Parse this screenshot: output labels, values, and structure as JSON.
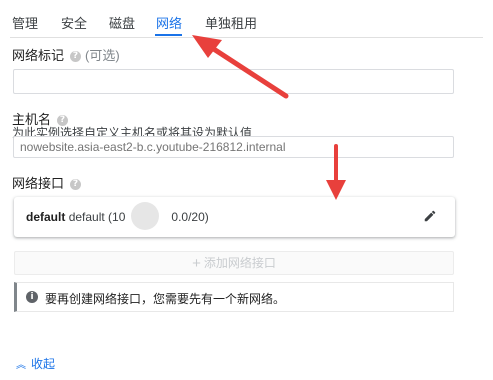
{
  "tabs": [
    {
      "label": "管理"
    },
    {
      "label": "安全"
    },
    {
      "label": "磁盘"
    },
    {
      "label": "网络"
    },
    {
      "label": "单独租用"
    }
  ],
  "network_tag": {
    "label": "网络标记",
    "optional": "(可选)",
    "value": ""
  },
  "hostname": {
    "label": "主机名",
    "description": "为此实例选择自定义主机名或将其设为默认值",
    "placeholder": "nowebsite.asia-east2-b.c.youtube-216812.internal"
  },
  "interfaces": {
    "label": "网络接口",
    "item_name": "default",
    "item_detail_prefix": "default (10",
    "item_detail_suffix": "0.0/20)"
  },
  "add_interface_label": "添加网络接口",
  "notice_text": "要再创建网络接口，您需要先有一个新网络。",
  "collapse_label": "收起",
  "colors": {
    "accent": "#1a73e8",
    "annotation_arrow": "#e8403c"
  },
  "icons": [
    "help-icon",
    "edit-icon",
    "plus-icon",
    "info-icon",
    "chevron-up-icon"
  ]
}
